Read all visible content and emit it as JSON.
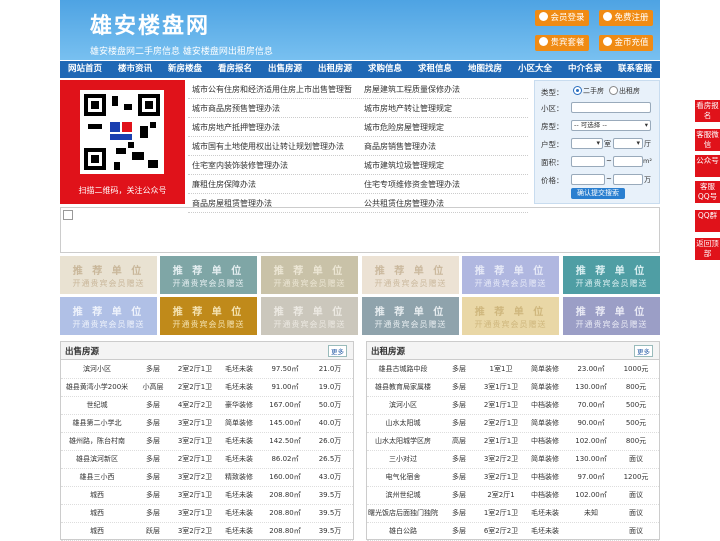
{
  "header": {
    "logo": "雄安楼盘网",
    "tagline": "雄安楼盘网二手房信息   雄安楼盘网出租房信息",
    "buttons": [
      "会员登录",
      "免费注册",
      "贵宾套餐",
      "金币充值"
    ]
  },
  "nav": [
    "网站首页",
    "楼市资讯",
    "新房楼盘",
    "看房报名",
    "出售房源",
    "出租房源",
    "求购信息",
    "求租信息",
    "地图找房",
    "小区大全",
    "中介名录",
    "联系客服"
  ],
  "qr": {
    "caption": "扫描二维码，关注公众号"
  },
  "links": {
    "left": [
      "城市公有住房和经济适用住房上市出售管理暂",
      "城市商品房预售管理办法",
      "城市房地产抵押管理办法",
      "城市国有土地使用权出让转让规划管理办法",
      "住宅室内装饰装修管理办法",
      "廉租住房保障办法",
      "商品房屋租赁管理办法"
    ],
    "right": [
      "房屋建筑工程质量保修办法",
      "城市房地产转让管理规定",
      "城市危险房屋管理规定",
      "商品房销售管理办法",
      "城市建筑垃圾管理规定",
      "住宅专项维修资金管理办法",
      "公共租赁住房管理办法"
    ]
  },
  "search": {
    "type_label": "类型：",
    "type_options": [
      "二手房",
      "出租房"
    ],
    "community_label": "小区：",
    "housetype_label": "房型：",
    "housetype_value": "-- 可选择 --",
    "layout_label": "户型：",
    "room_unit": "室",
    "hall_unit": "厅",
    "area_label": "面积：",
    "area_unit": "m²",
    "price_label": "价格：",
    "price_unit": "万",
    "range_sep": "~",
    "submit": "确认提交搜索"
  },
  "recommend": {
    "title": "推 荐 单 位",
    "subtitle": "开通贵宾会员赠送",
    "colors": [
      "#e9e2d2",
      "#7fa6a6",
      "#c9c2a8",
      "#ece2d4",
      "#b0b7e0",
      "#4f9ea4",
      "#b0c0e6",
      "#c08a1a",
      "#cbc7bc",
      "#8fa3ac",
      "#e9d7a6",
      "#9b9ec6"
    ],
    "text_colors": [
      "#c9b79a",
      "#e4eef0",
      "#ece6d4",
      "#cbb99e",
      "#e6e9f7",
      "#d8eef0",
      "#eef2fb",
      "#f4e2b0",
      "#ece9e2",
      "#e6ecef",
      "#cfb77d",
      "#e8e9f4"
    ]
  },
  "sale": {
    "title": "出售房源",
    "more": "更多",
    "rows": [
      [
        "滨河小区",
        "多层",
        "2室2厅1卫",
        "毛坯未装",
        "97.50㎡",
        "21.0万"
      ],
      [
        "雄县黄湾小学200米",
        "小高层",
        "2室2厅1卫",
        "毛坯未装",
        "91.00㎡",
        "19.0万"
      ],
      [
        "世纪城",
        "多层",
        "4室2厅2卫",
        "豪华装修",
        "167.00㎡",
        "50.0万"
      ],
      [
        "雄县第二小学北",
        "多层",
        "3室2厅1卫",
        "简单装修",
        "145.00㎡",
        "40.0万"
      ],
      [
        "雄州路，陈台村南",
        "多层",
        "3室2厅1卫",
        "毛坯未装",
        "142.50㎡",
        "26.0万"
      ],
      [
        "雄县滨河新区",
        "多层",
        "2室2厅1卫",
        "毛坯未装",
        "86.02㎡",
        "26.5万"
      ],
      [
        "雄县三小西",
        "多层",
        "3室2厅2卫",
        "精致装修",
        "160.00㎡",
        "43.0万"
      ],
      [
        "城西",
        "多层",
        "3室2厅1卫",
        "毛坯未装",
        "208.80㎡",
        "39.5万"
      ],
      [
        "城西",
        "多层",
        "3室2厅1卫",
        "毛坯未装",
        "208.80㎡",
        "39.5万"
      ],
      [
        "城西",
        "跃层",
        "3室2厅2卫",
        "毛坯未装",
        "208.80㎡",
        "39.5万"
      ]
    ]
  },
  "rent": {
    "title": "出租房源",
    "more": "更多",
    "rows": [
      [
        "雄县古城路中段",
        "多层",
        "1室1卫",
        "简单装修",
        "23.00㎡",
        "1000元"
      ],
      [
        "雄县教育局家属楼",
        "多层",
        "3室1厅1卫",
        "简单装修",
        "130.00㎡",
        "800元"
      ],
      [
        "滨河小区",
        "多层",
        "2室1厅1卫",
        "中档装修",
        "70.00㎡",
        "500元"
      ],
      [
        "山水太阳城",
        "多层",
        "2室2厅1卫",
        "简单装修",
        "90.00㎡",
        "500元"
      ],
      [
        "山水太阳城学区房",
        "高层",
        "2室1厅1卫",
        "中档装修",
        "102.00㎡",
        "800元"
      ],
      [
        "三小对过",
        "多层",
        "3室2厅2卫",
        "简单装修",
        "130.00㎡",
        "面议"
      ],
      [
        "电气化宿舍",
        "多层",
        "3室2厅1卫",
        "中档装修",
        "97.00㎡",
        "1200元"
      ],
      [
        "滨州世纪城",
        "多层",
        "2室2厅1",
        "中档装修",
        "102.00㎡",
        "面议"
      ],
      [
        "曙光饭店后面独门独院",
        "多层",
        "1室2厅1卫",
        "毛坯未装",
        "未知",
        "面议"
      ],
      [
        "雄白公路",
        "多层",
        "6室2厅2卫",
        "毛坯未装",
        "",
        "面议"
      ]
    ]
  },
  "side": [
    "看房报名",
    "客服微信",
    "公众号",
    "客服QQ号",
    "QQ群",
    "返回顶部"
  ]
}
